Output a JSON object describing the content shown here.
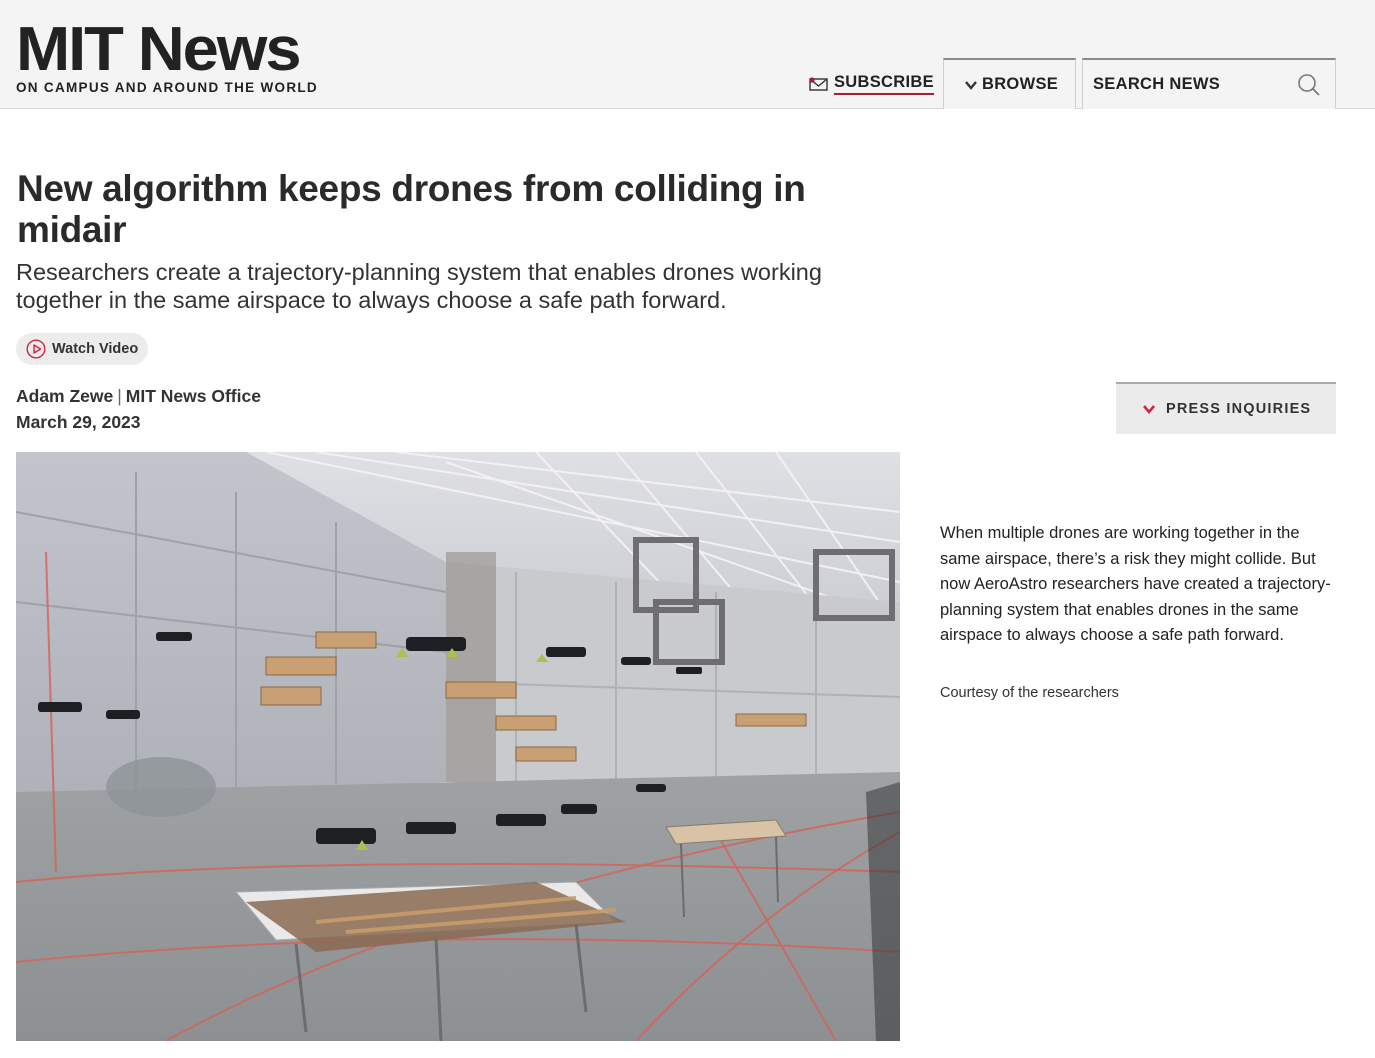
{
  "header": {
    "logo_title": "MIT News",
    "logo_tagline": "ON CAMPUS AND AROUND THE WORLD",
    "subscribe_label": "SUBSCRIBE",
    "browse_label": "BROWSE",
    "search_placeholder": "SEARCH NEWS",
    "accent_color": "#a31f34"
  },
  "article": {
    "title": "New algorithm keeps drones from colliding in midair",
    "subtitle": "Researchers create a trajectory-planning system that enables drones working together in the same airspace to always choose a safe path forward.",
    "watch_video_label": "Watch Video",
    "author": "Adam Zewe",
    "byline_separator": "|",
    "office": "MIT News Office",
    "date": "March 29, 2023",
    "press_inquiries_label": "PRESS INQUIRIES",
    "image": {
      "caption": "When multiple drones are working together in the same airspace, there’s a risk they might collide. But now AeroAstro researchers have created a trajectory-planning system that enables drones in the same airspace to always choose a safe path forward.",
      "credit": "Courtesy of the researchers"
    }
  },
  "icons": {
    "subscribe": "mail-icon",
    "browse": "chevron-down-icon",
    "search": "search-icon",
    "watch": "play-icon",
    "press": "chevron-down-icon"
  }
}
